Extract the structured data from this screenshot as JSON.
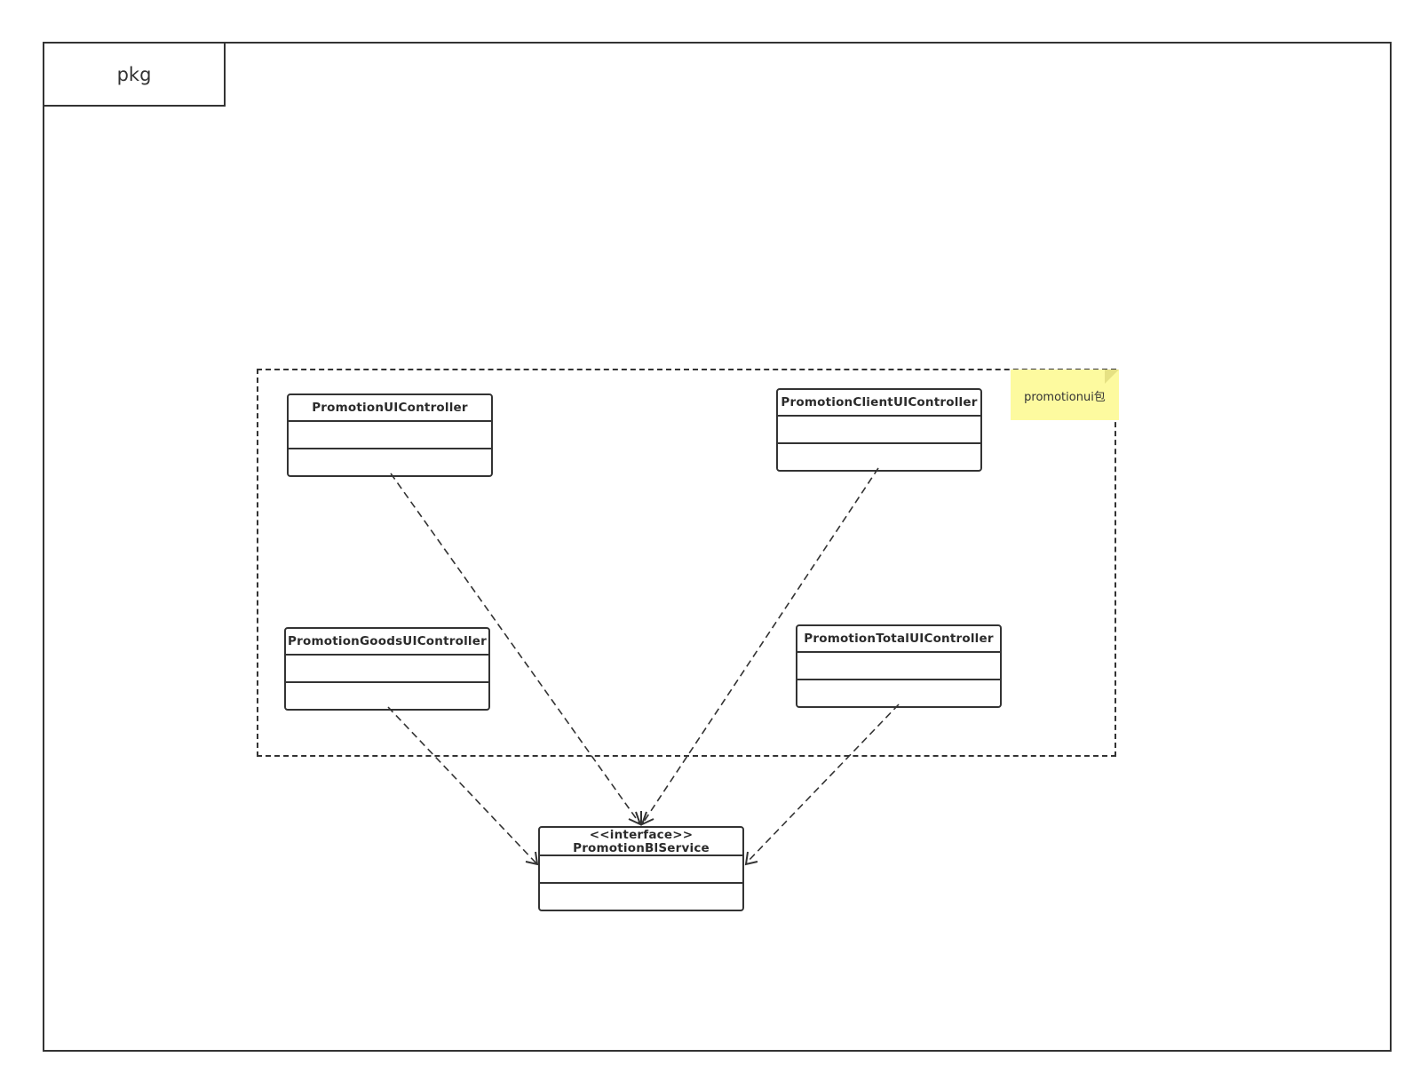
{
  "frame": {
    "tab_label": "pkg"
  },
  "note": {
    "text": "promotionui包"
  },
  "classes": {
    "promotion_ui_controller": {
      "name": "PromotionUIController"
    },
    "promotion_client_ui_controller": {
      "name": "PromotionClientUIController"
    },
    "promotion_goods_ui_controller": {
      "name": "PromotionGoodsUIController"
    },
    "promotion_total_ui_controller": {
      "name": "PromotionTotalUIController"
    },
    "promotion_bl_service": {
      "stereotype": "<<interface>>",
      "name": "PromotionBlService"
    }
  },
  "dependencies": [
    {
      "from": "PromotionUIController",
      "to": "PromotionBlService",
      "style": "dashed-open-arrow"
    },
    {
      "from": "PromotionClientUIController",
      "to": "PromotionBlService",
      "style": "dashed-open-arrow"
    },
    {
      "from": "PromotionGoodsUIController",
      "to": "PromotionBlService",
      "style": "dashed-open-arrow"
    },
    {
      "from": "PromotionTotalUIController",
      "to": "PromotionBlService",
      "style": "dashed-open-arrow"
    }
  ],
  "colors": {
    "stroke": "#333333",
    "note_fill": "#fdfa9f",
    "background": "#ffffff"
  }
}
